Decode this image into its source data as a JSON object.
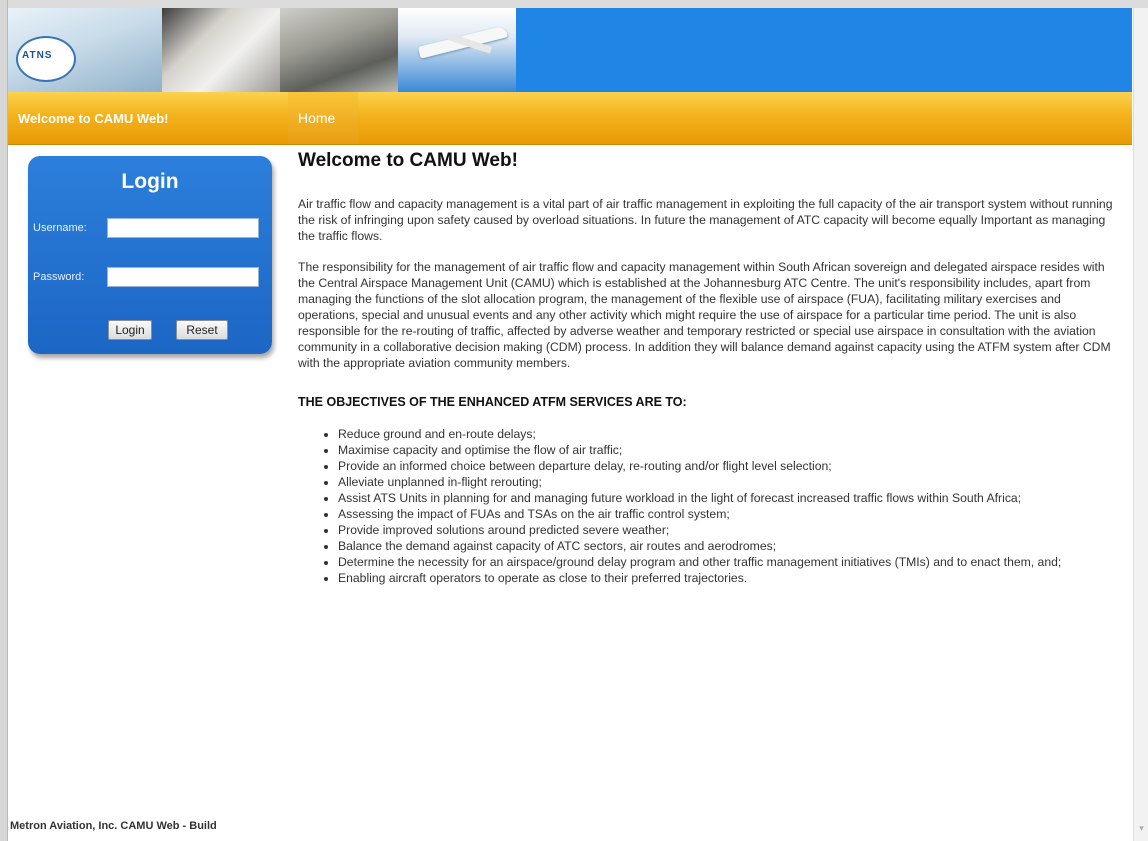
{
  "header": {
    "logo_text": "ATNS"
  },
  "nav": {
    "brand": "Welcome to CAMU Web!",
    "tabs": [
      {
        "label": "Home"
      }
    ]
  },
  "login": {
    "title": "Login",
    "username_label": "Username:",
    "username_value": "",
    "password_label": "Password:",
    "password_value": "",
    "login_button": "Login",
    "reset_button": "Reset"
  },
  "main": {
    "title": "Welcome to CAMU Web!",
    "paragraphs": [
      "Air traffic flow and capacity management is a vital part of air traffic management in exploiting the full capacity of the air transport system without running the risk of infringing upon safety caused by overload situations. In future the management of ATC capacity will become equally Important as managing the traffic flows.",
      "The responsibility for the management of air traffic flow and capacity management within South African sovereign and delegated airspace resides with the Central Airspace Management Unit (CAMU) which is established at the Johannesburg ATC Centre. The unit's responsibility includes, apart from managing the functions of the slot allocation program, the management of the flexible use of airspace (FUA), facilitating military exercises and operations, special and unusual events and any other activity which might require the use of airspace for a particular time period. The unit is also responsible for the re-routing of traffic, affected by adverse weather and temporary restricted or special use airspace in consultation with the aviation community in a collaborative decision making (CDM) process. In addition they will balance demand against capacity using the ATFM system after CDM with the appropriate aviation community members."
    ],
    "objectives_heading": "THE OBJECTIVES OF THE ENHANCED ATFM SERVICES ARE TO:",
    "objectives": [
      "Reduce ground and en-route delays;",
      "Maximise capacity and optimise the flow of air traffic;",
      "Provide an informed choice between departure delay, re-routing and/or flight level selection;",
      "Alleviate unplanned in-flight rerouting;",
      "Assist ATS Units in planning for and managing future workload in the light of forecast increased traffic flows within South Africa;",
      "Assessing the impact of FUAs and TSAs on the air traffic control system;",
      "Provide improved solutions around predicted severe weather;",
      "Balance the demand against capacity of ATC sectors, air routes and aerodromes;",
      "Determine the necessity for an airspace/ground delay program and other traffic management initiatives (TMIs) and to enact them, and;",
      "Enabling aircraft operators to operate as close to their preferred trajectories."
    ]
  },
  "footer": {
    "text": "Metron Aviation, Inc. CAMU Web - Build"
  }
}
